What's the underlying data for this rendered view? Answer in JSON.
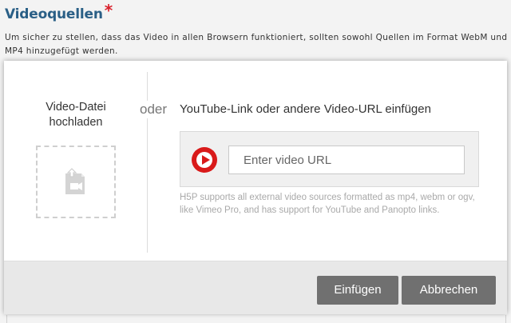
{
  "field": {
    "title": "Videoquellen",
    "required_marker": "*",
    "description": "Um sicher zu stellen, dass das Video in allen Browsern funktioniert, sollten sowohl Quellen im Format WebM und MP4 hinzugefügt werden."
  },
  "dialog": {
    "upload": {
      "title": "Video-Datei hochladen",
      "icon": "upload-video-icon"
    },
    "or_label": "oder",
    "url": {
      "title": "YouTube-Link oder andere Video-URL einfügen",
      "icon": "play-icon",
      "input_placeholder": "Enter video URL",
      "input_value": "",
      "hint": "H5P supports all external video sources formatted as mp4, webm or ogv, like Vimeo Pro, and has support for YouTube and Panopto links."
    },
    "footer": {
      "insert_label": "Einfügen",
      "cancel_label": "Abbrechen"
    }
  },
  "colors": {
    "title": "#2a5f86",
    "required": "#d9202b",
    "play_red": "#d91a1a",
    "button_bg": "#707070",
    "footer_bg": "#e8e8e8"
  }
}
